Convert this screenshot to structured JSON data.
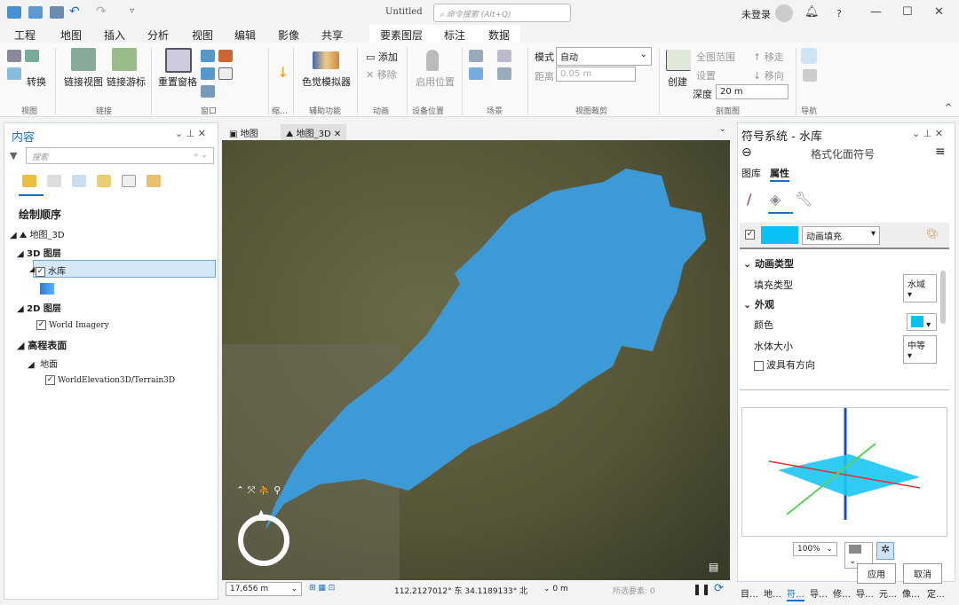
{
  "titlebar": {
    "title": "Untitled",
    "search_placeholder": "命令搜索 (Alt+Q)",
    "user": "未登录",
    "icons": [
      "new-project-icon",
      "open-icon",
      "save-icon",
      "undo-icon",
      "redo-icon",
      "customize-icon"
    ]
  },
  "tabs": [
    "工程",
    "地图",
    "插入",
    "分析",
    "视图",
    "编辑",
    "影像",
    "共享"
  ],
  "context_tabs": [
    "要素图层",
    "标注",
    "数据"
  ],
  "ribbon": {
    "view": {
      "convert": "转换",
      "group": "视图"
    },
    "link": {
      "link_views": "链接视图",
      "link_cursor": "链接游标",
      "group": "链接"
    },
    "window": {
      "reset": "重置窗格",
      "group": "窗口"
    },
    "thumb": {
      "group": "缩…"
    },
    "accessibility": {
      "cvd": "色觉模拟器",
      "group": "辅助功能"
    },
    "animation": {
      "add": "添加",
      "remove": "移除",
      "group": "动画"
    },
    "device": {
      "enable": "启用位置",
      "group": "设备位置"
    },
    "scene": {
      "group": "场景"
    },
    "clip": {
      "mode_label": "模式",
      "mode": "自动",
      "distance_label": "距离",
      "distance": "0.05  m",
      "group": "视图裁剪"
    },
    "profile": {
      "create": "创建",
      "full_extent": "全图范围",
      "settings": "设置",
      "move_away": "移走",
      "move_toward": "移向",
      "depth_label": "深度",
      "depth": "20 m",
      "group": "剖面图"
    },
    "nav": {
      "group": "导航"
    }
  },
  "contents": {
    "title": "内容",
    "search_placeholder": "搜索",
    "draw_order": "绘制顺序",
    "map": "地图_3D",
    "layers3d": "3D 图层",
    "reservoir": "水库",
    "layers2d": "2D 图层",
    "imagery": "World Imagery",
    "elevation": "高程表面",
    "ground": "地面",
    "terrain": "WorldElevation3D/Terrain3D"
  },
  "map_tabs": [
    "地图",
    "地图_3D"
  ],
  "status": {
    "scale": "17,656 m",
    "coords": "112.2127012° 东 34.1189133° 北",
    "elev": "0 m",
    "selected": "所选要素: 0"
  },
  "symbology": {
    "title": "符号系统 - 水库",
    "subtitle": "格式化面符号",
    "tab_gallery": "图库",
    "tab_properties": "属性",
    "fill": "动画填充",
    "sec_anim": "动画类型",
    "fill_type_label": "填充类型",
    "fill_type": "水域",
    "sec_appearance": "外观",
    "color_label": "颜色",
    "wave_size_label": "水体大小",
    "wave_size": "中等",
    "wave_dir": "波具有方向",
    "zoom": "100%",
    "apply": "应用",
    "cancel": "取消",
    "water_color": "#0ac0f5"
  },
  "bottom_tabs": [
    "目…",
    "地…",
    "符…",
    "导…",
    "修…",
    "导…",
    "元…",
    "像…",
    "定…"
  ],
  "colors": {
    "accent": "#1b6ec2",
    "lake": "#3e9ad6"
  }
}
